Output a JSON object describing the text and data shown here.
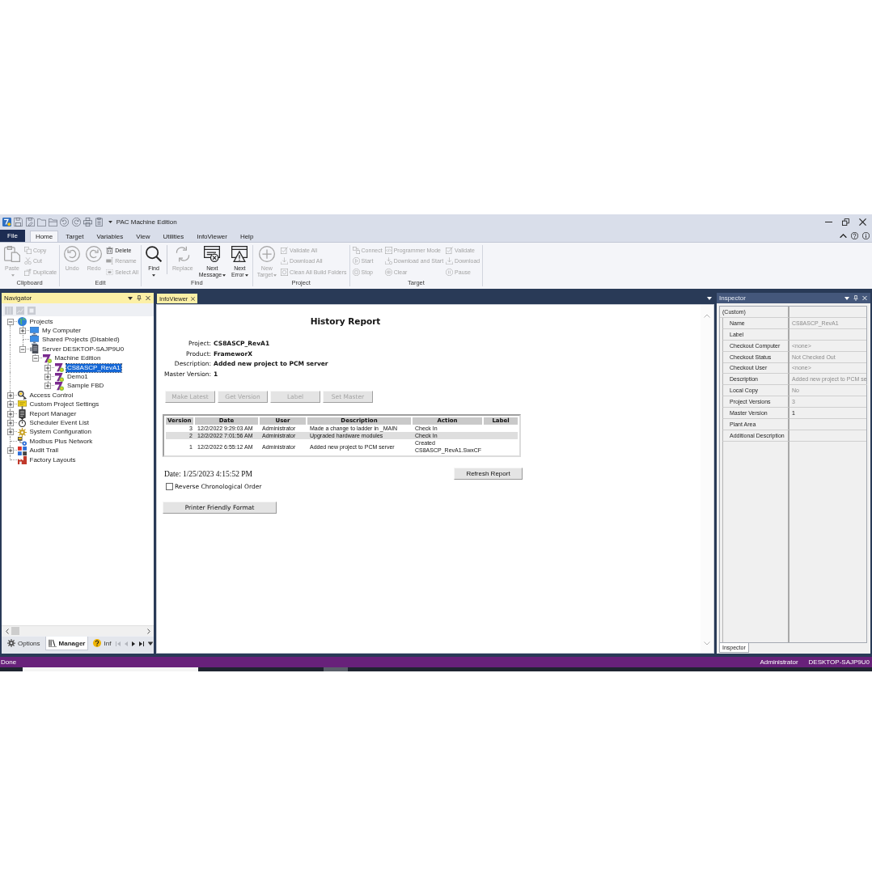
{
  "window": {
    "title": "PAC Machine Edition"
  },
  "ribbon": {
    "tabs": [
      {
        "label": "File",
        "kind": "backstage",
        "selected": false
      },
      {
        "label": "Home",
        "kind": "tab",
        "selected": true
      },
      {
        "label": "Target",
        "kind": "tab",
        "selected": false
      },
      {
        "label": "Variables",
        "kind": "tab",
        "selected": false
      },
      {
        "label": "View",
        "kind": "tab",
        "selected": false
      },
      {
        "label": "Utilities",
        "kind": "tab",
        "selected": false
      },
      {
        "label": "InfoViewer",
        "kind": "tab",
        "selected": false
      },
      {
        "label": "Help",
        "kind": "tab",
        "selected": false
      }
    ],
    "groups": [
      {
        "label": "Clipboard",
        "items": [
          {
            "kind": "large",
            "label": "Paste",
            "disabled": true,
            "dropdown": true
          },
          {
            "kind": "small",
            "label": "Copy",
            "disabled": true
          },
          {
            "kind": "small",
            "label": "Cut",
            "disabled": true
          },
          {
            "kind": "small",
            "label": "Duplicate",
            "disabled": true
          }
        ]
      },
      {
        "label": "Edit",
        "items": [
          {
            "kind": "large",
            "label": "Undo",
            "disabled": true,
            "dropdown": false
          },
          {
            "kind": "large",
            "label": "Redo",
            "disabled": true,
            "dropdown": false
          },
          {
            "kind": "small",
            "label": "Delete",
            "disabled": false
          },
          {
            "kind": "small",
            "label": "Rename",
            "disabled": true
          },
          {
            "kind": "small",
            "label": "Select All",
            "disabled": true
          }
        ]
      },
      {
        "label": "Find",
        "items": [
          {
            "kind": "large",
            "label": "Find",
            "disabled": false,
            "dropdown": true
          },
          {
            "kind": "large",
            "label": "Replace",
            "disabled": true,
            "dropdown": false
          },
          {
            "kind": "large",
            "label": "Next Message",
            "disabled": false,
            "dropdown": true
          },
          {
            "kind": "large",
            "label": "Next Error",
            "disabled": false,
            "dropdown": true
          }
        ]
      },
      {
        "label": "Project",
        "items": [
          {
            "kind": "large",
            "label": "New Target",
            "disabled": true,
            "dropdown": true
          },
          {
            "kind": "small",
            "label": "Validate All",
            "disabled": true
          },
          {
            "kind": "small",
            "label": "Download All",
            "disabled": true
          },
          {
            "kind": "small",
            "label": "Clean All Build Folders",
            "disabled": true
          }
        ]
      },
      {
        "label": "Target",
        "items": [
          {
            "kind": "small",
            "label": "Connect",
            "disabled": true
          },
          {
            "kind": "small",
            "label": "Start",
            "disabled": true
          },
          {
            "kind": "small",
            "label": "Stop",
            "disabled": true
          },
          {
            "kind": "small",
            "label": "Programmer Mode",
            "disabled": true
          },
          {
            "kind": "small",
            "label": "Download and Start",
            "disabled": true
          },
          {
            "kind": "small",
            "label": "Clear",
            "disabled": true
          },
          {
            "kind": "small",
            "label": "Validate",
            "disabled": true
          },
          {
            "kind": "small",
            "label": "Download",
            "disabled": true
          },
          {
            "kind": "small",
            "label": "Pause",
            "disabled": true
          }
        ]
      }
    ]
  },
  "navigator": {
    "title": "Navigator",
    "toolbar": [
      {
        "disabled": true
      },
      {
        "disabled": true
      },
      {
        "disabled": true
      }
    ],
    "tree": [
      {
        "label": "Projects",
        "kind": "branch",
        "expanded": true,
        "selected": false,
        "children": [
          {
            "label": "My Computer",
            "kind": "branch",
            "expanded": false,
            "selected": false
          },
          {
            "label": "Shared Projects (Disabled)",
            "kind": "leaf",
            "selected": false
          },
          {
            "label": "Server DESKTOP-SAJP9U0",
            "kind": "branch",
            "expanded": true,
            "selected": false,
            "children": [
              {
                "label": "Machine Edition",
                "kind": "branch",
                "expanded": true,
                "selected": false,
                "children": [
                  {
                    "label": "CS8ASCP_RevA1",
                    "kind": "branch",
                    "expanded": false,
                    "selected": true
                  },
                  {
                    "label": "Demo1",
                    "kind": "branch",
                    "expanded": false,
                    "selected": false
                  },
                  {
                    "label": "Sample FBD",
                    "kind": "branch",
                    "expanded": false,
                    "selected": false
                  }
                ]
              }
            ]
          }
        ]
      },
      {
        "label": "Access Control",
        "kind": "branch",
        "expanded": false,
        "selected": false
      },
      {
        "label": "Custom Project Settings",
        "kind": "branch",
        "expanded": false,
        "selected": false
      },
      {
        "label": "Report Manager",
        "kind": "branch",
        "expanded": false,
        "selected": false
      },
      {
        "label": "Scheduler Event List",
        "kind": "branch",
        "expanded": false,
        "selected": false
      },
      {
        "label": "System Configuration",
        "kind": "branch",
        "expanded": false,
        "selected": false
      },
      {
        "label": "Modbus Plus Network",
        "kind": "leaf",
        "selected": false
      },
      {
        "label": "Audit Trail",
        "kind": "branch",
        "expanded": false,
        "selected": false
      },
      {
        "label": "Factory Layouts",
        "kind": "leaf",
        "selected": false
      }
    ],
    "tabs": [
      {
        "label": "Options",
        "selected": false
      },
      {
        "label": "Manager",
        "selected": true
      },
      {
        "label": "Inf",
        "selected": false
      }
    ],
    "tab_scroll": {
      "back_enabled": false,
      "forward_enabled": true
    }
  },
  "document": {
    "tabs": [
      {
        "label": "InfoViewer",
        "selected": true
      }
    ],
    "report": {
      "title": "History Report",
      "fields": [
        {
          "label": "Project:",
          "value": "CS8ASCP_RevA1"
        },
        {
          "label": "Product:",
          "value": "FrameworX"
        },
        {
          "label": "Description:",
          "value": "Added new project to PCM server"
        },
        {
          "label": "Master Version:",
          "value": "1"
        }
      ],
      "buttons": [
        {
          "label": "Make Latest",
          "disabled": true
        },
        {
          "label": "Get Version",
          "disabled": true
        },
        {
          "label": "Label",
          "disabled": true
        },
        {
          "label": "Set Master",
          "disabled": true
        }
      ],
      "history": {
        "columns": [
          "Version",
          "Date",
          "User",
          "Description",
          "Action",
          "Label"
        ],
        "rows": [
          [
            "3",
            "12/2/2022 9:29:03 AM",
            "Administrator",
            "Made a change to ladder in _MAIN",
            "Check In"
          ],
          [
            "2",
            "12/2/2022 7:01:56 AM",
            "Administrator",
            "Upgraded hardware modules",
            "Check In"
          ],
          [
            "1",
            "12/2/2022 6:55:12 AM",
            "Administrator",
            "Added new project to PCM server",
            "Created CS8ASCP_RevA1.SwxCF"
          ]
        ]
      },
      "date": "Date: 1/25/2023 4:15:52 PM",
      "refresh_button": "Refresh Report",
      "reverse_order": {
        "label": "Reverse Chronological Order",
        "checked": false
      },
      "print_button": "Printer Friendly Format"
    }
  },
  "inspector": {
    "title": "Inspector",
    "category": "(Custom)",
    "properties": [
      {
        "name": "Name",
        "value": "CS8ASCP_RevA1",
        "readonly": true
      },
      {
        "name": "Label"
      },
      {
        "name": "Checkout Computer",
        "value": "<none>",
        "readonly": true
      },
      {
        "name": "Checkout Status",
        "value": "Not Checked Out",
        "readonly": true
      },
      {
        "name": "Checkout User",
        "value": "<none>",
        "readonly": true
      },
      {
        "name": "Description",
        "value": "Added new project to PCM se",
        "readonly": true
      },
      {
        "name": "Local Copy",
        "value": "No",
        "readonly": true
      },
      {
        "name": "Project Versions",
        "value": "3",
        "readonly": true
      },
      {
        "name": "Master Version",
        "value": "1",
        "readonly": false
      },
      {
        "name": "Plant Area"
      },
      {
        "name": "Additional Description"
      }
    ],
    "tabs": [
      {
        "label": "Inspector",
        "selected": true
      }
    ]
  },
  "status_bar": {
    "message": "Done",
    "user": "Administrator",
    "computer": "DESKTOP-SAJP9U0"
  }
}
